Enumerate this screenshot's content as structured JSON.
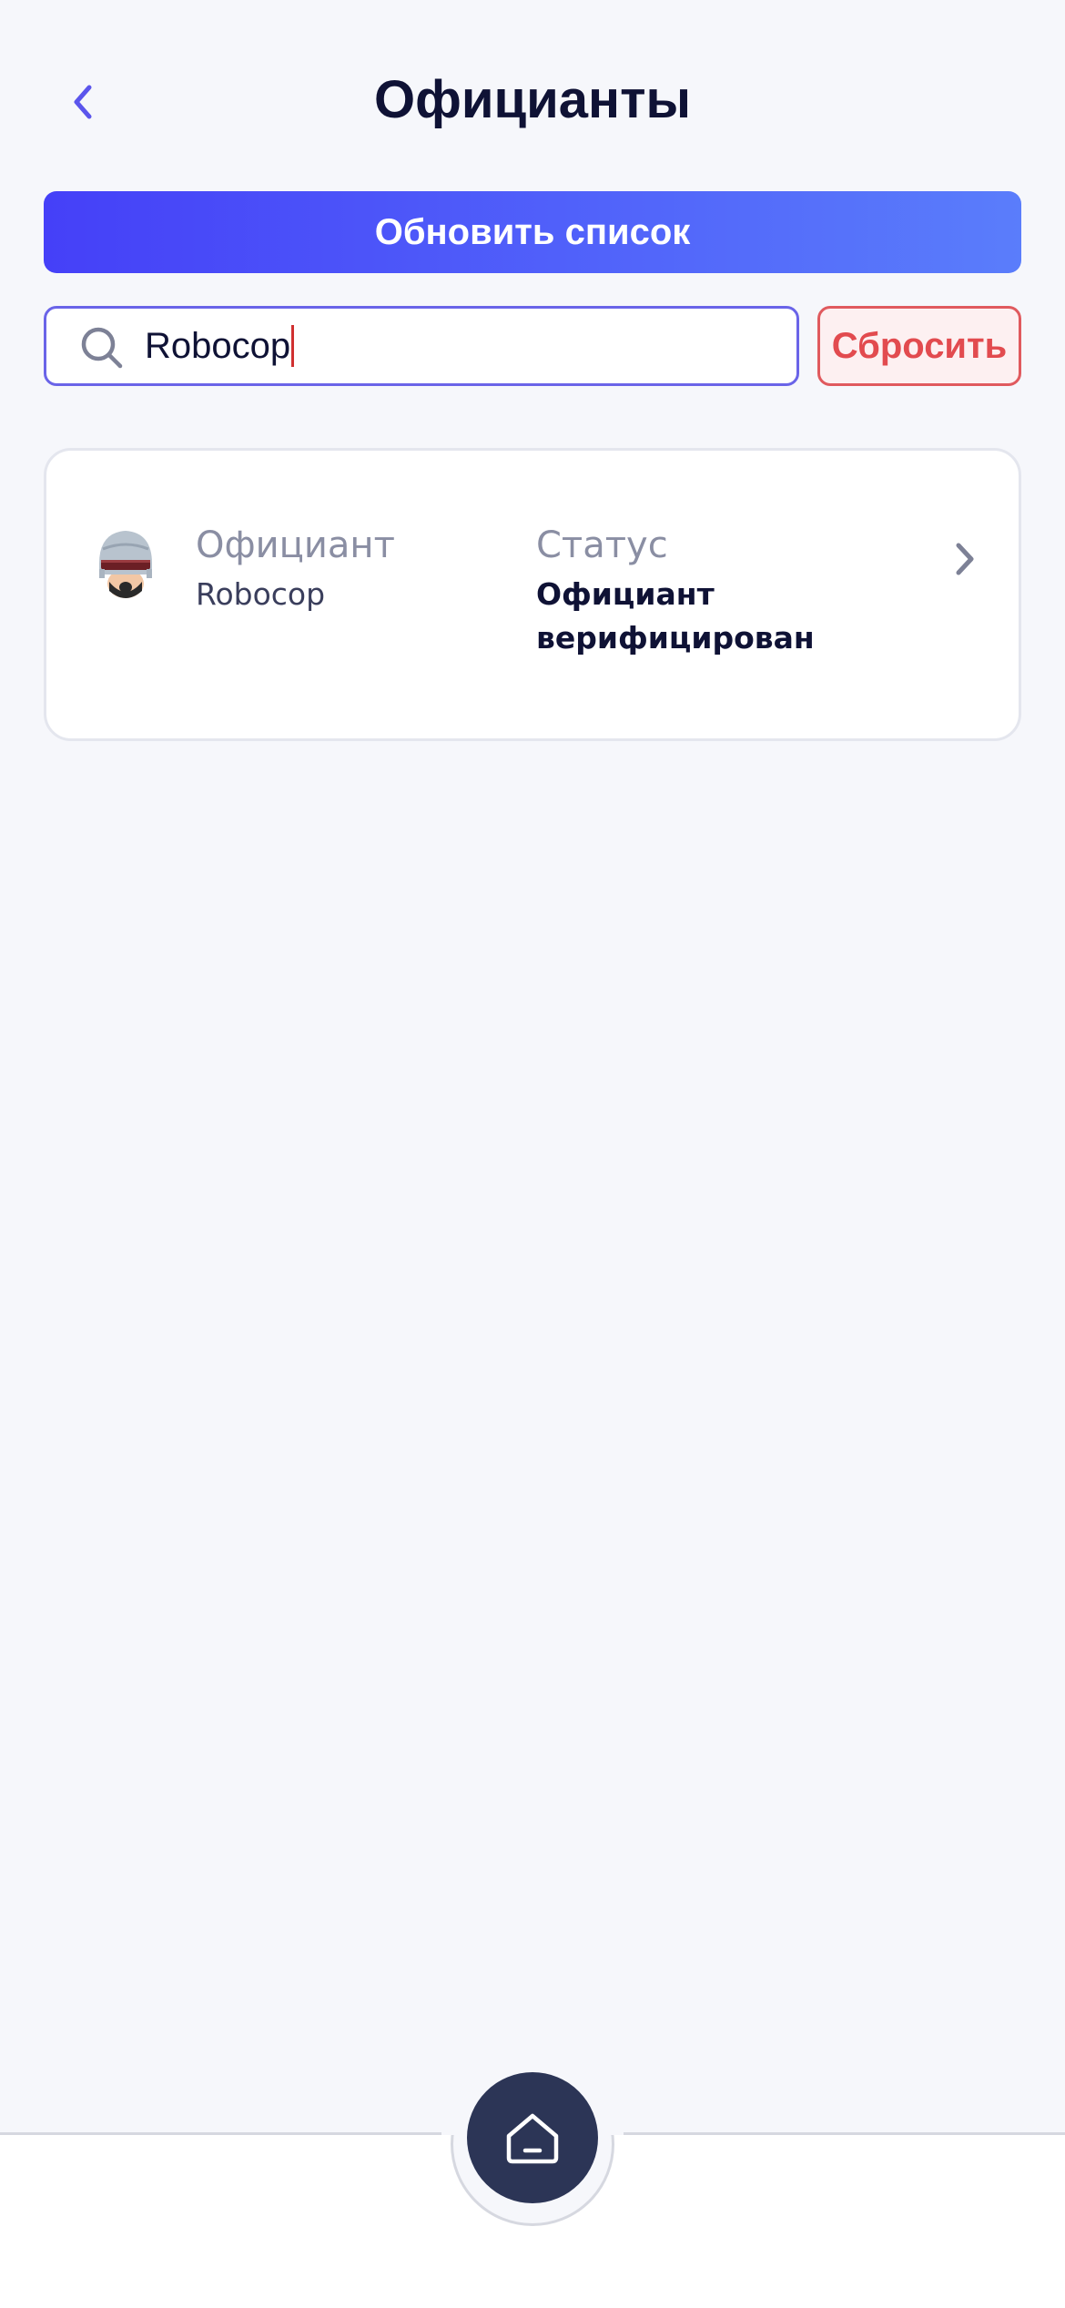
{
  "header": {
    "title": "Официанты",
    "back_icon": "chevron-left-icon"
  },
  "actions": {
    "refresh_label": "Обновить список",
    "reset_label": "Сбросить"
  },
  "search": {
    "value": "Robocop",
    "icon": "search-icon"
  },
  "waiters": [
    {
      "name_label": "Официант",
      "name": "Robocop",
      "status_label": "Статус",
      "status": "Официант верифицирован",
      "avatar_icon": "robocop-avatar-icon"
    }
  ],
  "bottom_nav": {
    "home_icon": "home-icon"
  },
  "colors": {
    "accent_start": "#4540f8",
    "accent_end": "#5a7dfb",
    "danger": "#e24b4f",
    "title": "#0f1235",
    "nav": "#2c3556"
  }
}
